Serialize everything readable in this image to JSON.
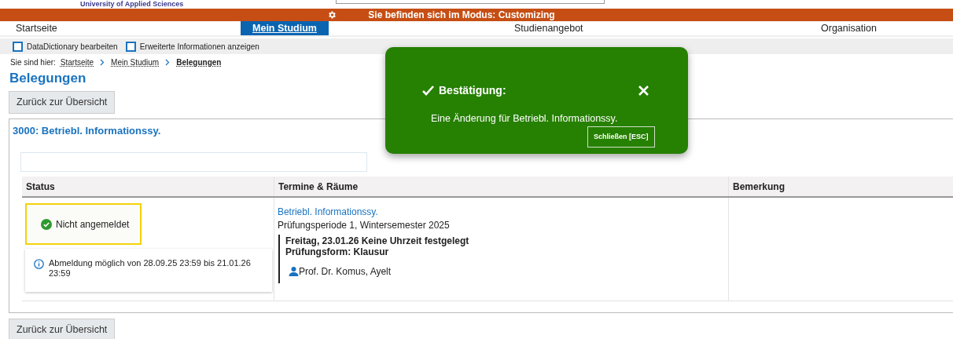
{
  "header": {
    "logo_subtitle": "University of Applied Sciences"
  },
  "mode_bar": {
    "text": "Sie befinden sich im Modus: Customizing"
  },
  "nav": [
    {
      "label": "Startseite",
      "selected": false
    },
    {
      "label": "Mein Studium",
      "selected": true
    },
    {
      "label": "Studienangebot",
      "selected": false
    },
    {
      "label": "Organisation",
      "selected": false
    }
  ],
  "options": [
    {
      "label": "DataDictionary bearbeiten",
      "checked": false
    },
    {
      "label": "Erweiterte Informationen anzeigen",
      "checked": false
    }
  ],
  "breadcrumb": {
    "prefix": "Sie sind hier:",
    "items": [
      "Startseite",
      "Mein Studium",
      "Belegungen"
    ]
  },
  "page_title": "Belegungen",
  "back_button": "Zurück zur Übersicht",
  "module": {
    "title": "3000: Betriebl. Informationssy.",
    "table": {
      "columns": [
        "Status",
        "Termine & Räume",
        "Bemerkung"
      ],
      "rows": [
        {
          "status": "Nicht angemeldet",
          "info": "Abmeldung möglich von 28.09.25 23:59 bis 21.01.26 23:59",
          "exam_link": "Betriebl. Informationssy.",
          "period": "Prüfungsperiode 1, Wintersemester 2025",
          "date": "Freitag, 23.01.26 Keine Uhrzeit festgelegt",
          "form": "Prüfungsform: Klausur",
          "examiner": "Prof. Dr. Komus, Ayelt"
        }
      ]
    }
  },
  "back_button_bottom": "Zurück zur Übersicht",
  "toast": {
    "title": "Bestätigung:",
    "message": "Eine Änderung für Betriebl. Informationssy.",
    "close_button": "Schließen [ESC]"
  }
}
